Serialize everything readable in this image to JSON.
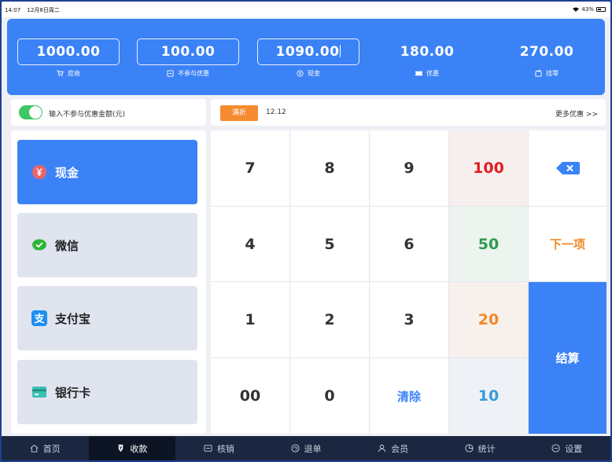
{
  "status": {
    "time": "14:07",
    "date": "12月8日周二",
    "battery": "43%"
  },
  "amounts": {
    "receivable": {
      "value": "1000.00",
      "label": "应收"
    },
    "excluded": {
      "value": "100.00",
      "label": "不参与优惠"
    },
    "cash": {
      "value": "1090.00",
      "label": "现金"
    },
    "discount": {
      "value": "180.00",
      "label": "优惠"
    },
    "change": {
      "value": "270.00",
      "label": "找零"
    }
  },
  "toggle": {
    "label": "输入不参与优惠金额(元)",
    "on": true
  },
  "promo": {
    "tag": "满折",
    "value": "12.12",
    "more": "更多优惠 >>"
  },
  "methods": [
    {
      "label": "现金",
      "icon": "yuan-icon"
    },
    {
      "label": "微信",
      "icon": "wechat-icon"
    },
    {
      "label": "支付宝",
      "icon": "alipay-icon"
    },
    {
      "label": "银行卡",
      "icon": "bank-card-icon"
    }
  ],
  "keypad": {
    "k7": "7",
    "k8": "8",
    "k9": "9",
    "k100": "100",
    "k4": "4",
    "k5": "5",
    "k6": "6",
    "k50": "50",
    "next": "下一项",
    "k1": "1",
    "k2": "2",
    "k3": "3",
    "k20": "20",
    "settle": "结算",
    "k00": "00",
    "k0": "0",
    "clear": "清除",
    "k10": "10"
  },
  "colors": {
    "accent": "#3b82f6",
    "red": "#e02020",
    "green": "#2e9a4e",
    "orange": "#f08a25",
    "blue10": "#3a9ad9"
  },
  "tabs": [
    {
      "label": "首页",
      "icon": "home-icon"
    },
    {
      "label": "收款",
      "icon": "payment-icon",
      "active": true
    },
    {
      "label": "核销",
      "icon": "verify-icon"
    },
    {
      "label": "退单",
      "icon": "refund-icon"
    },
    {
      "label": "会员",
      "icon": "member-icon"
    },
    {
      "label": "统计",
      "icon": "stats-icon"
    },
    {
      "label": "设置",
      "icon": "settings-icon"
    }
  ]
}
